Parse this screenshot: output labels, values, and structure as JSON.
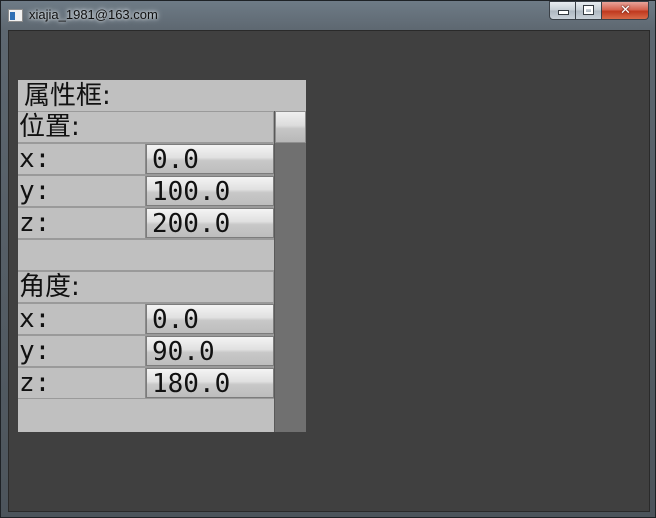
{
  "window": {
    "title": "xiajia_1981@163.com",
    "icon": "app-window-icon",
    "buttons": {
      "minimize_icon": "minimize-icon",
      "maximize_icon": "maximize-icon",
      "close_icon": "close-icon",
      "close_glyph": "✕"
    }
  },
  "panel": {
    "title": "属性框:",
    "position_section": {
      "label": "位置:",
      "rows": [
        {
          "label": "x:",
          "value": "0.0"
        },
        {
          "label": "y:",
          "value": "100.0"
        },
        {
          "label": "z:",
          "value": "200.0"
        }
      ]
    },
    "angle_section": {
      "label": "角度:",
      "rows": [
        {
          "label": "x:",
          "value": "0.0"
        },
        {
          "label": "y:",
          "value": "90.0"
        },
        {
          "label": "z:",
          "value": "180.0"
        }
      ]
    },
    "scroll_position": 0
  },
  "colors": {
    "client_background": "#404040",
    "panel_background": "#c0c0c0",
    "scrollbar_track": "#707070",
    "close_button": "#c0391f"
  }
}
